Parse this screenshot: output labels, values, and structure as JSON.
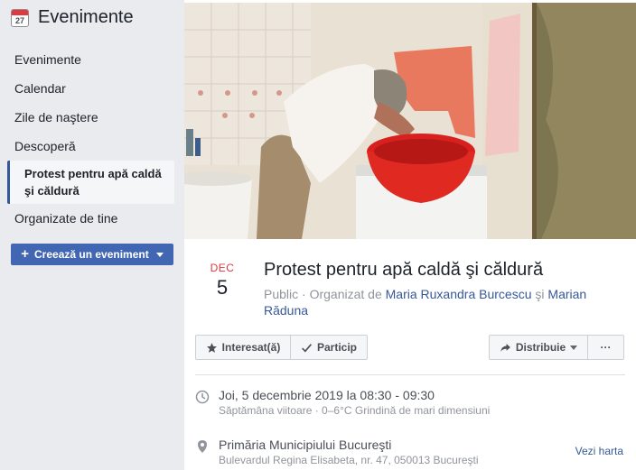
{
  "sidebar": {
    "title": "Evenimente",
    "calendar_icon_day": "27",
    "items": [
      {
        "label": "Evenimente"
      },
      {
        "label": "Calendar"
      },
      {
        "label": "Zile de naştere"
      },
      {
        "label": "Descoperă"
      },
      {
        "label": "Protest pentru apă caldă şi căldură"
      },
      {
        "label": "Organizate de tine"
      }
    ],
    "create_button": "Creează un eveniment"
  },
  "event": {
    "cover_alt": "Elderly man washing his face over a red plastic basin in a bathroom",
    "date_month": "DEC",
    "date_day": "5",
    "title": "Protest pentru apă caldă şi căldură",
    "privacy": "Public",
    "organized_by": "· Organizat de",
    "organizer_1": "Maria Ruxandra Burcescu",
    "and": "şi",
    "organizer_2": "Marian Răduna"
  },
  "actions": {
    "interested": "Interesat(ă)",
    "going": "Particip",
    "share": "Distribuie",
    "more": "···"
  },
  "details": {
    "time_main": "Joi, 5 decembrie 2019 la 08:30 - 09:30",
    "time_sub": "Săptămâna viitoare · 0–6°C Grindină de mari dimensiuni",
    "place_main": "Primăria Municipiului Bucureşti",
    "place_sub": "Bulevardul Regina Elisabeta, nr. 47, 050013 Bucureşti",
    "map_link": "Vezi harta"
  },
  "colors": {
    "accent": "#4267b2",
    "link": "#365899",
    "month_red": "#e0393e",
    "basin_red": "#d8211f",
    "towel_orange": "#e8795e"
  }
}
